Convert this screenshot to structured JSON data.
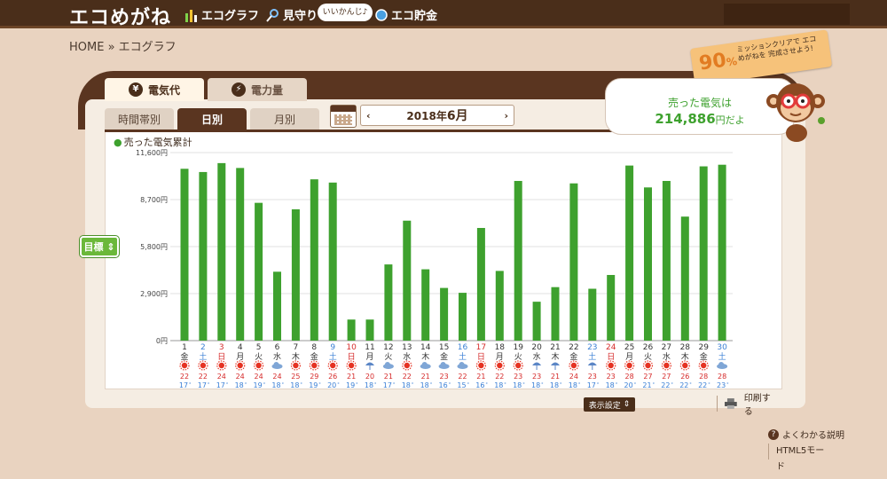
{
  "header": {
    "logo": "エコめがね",
    "nav": [
      {
        "label": "エコグラフ",
        "icon": "bar-chart-icon"
      },
      {
        "label": "見守り",
        "icon": "magnifier-icon"
      },
      {
        "label": "エコ貯金",
        "icon": "coin-icon"
      }
    ],
    "speech": "いいかんじ♪"
  },
  "breadcrumb": "HOME » エコグラフ",
  "mission": {
    "percent": "90",
    "unit": "%",
    "text": "ミッションクリアで エコめがねを 完成させよう!"
  },
  "tabs": [
    {
      "label": "電気代",
      "icon": "yen-icon"
    },
    {
      "label": "電力量",
      "icon": "bolt-icon"
    }
  ],
  "subtabs": [
    "時間帯別",
    "日別",
    "月別"
  ],
  "month": {
    "year": "2018年",
    "month": "6月",
    "prev": "‹",
    "next": "›"
  },
  "bubble": {
    "line1": "売った電気は",
    "amount": "214,886",
    "unit": "円だよ"
  },
  "legend": "売った電気累計",
  "goal_button": "目標",
  "display_button": "表示設定",
  "print_button": "印刷する",
  "faq": "よくわかる説明",
  "html5": "HTML5モード",
  "colors": {
    "bar": "#3ea12e",
    "brown": "#4a2e1a",
    "sat": "#3a7fd5",
    "sun": "#d62b2b",
    "hi": "#d62b2b",
    "lo": "#3a7fd5"
  },
  "chart_data": {
    "type": "bar",
    "title": "売った電気累計",
    "ylim": [
      0,
      11600
    ],
    "y_ticks": [
      "0円",
      "2,900円",
      "5,800円",
      "8,700円",
      "11,600円"
    ],
    "categories": [
      "1",
      "2",
      "3",
      "4",
      "5",
      "6",
      "7",
      "8",
      "9",
      "10",
      "11",
      "12",
      "13",
      "14",
      "15",
      "16",
      "17",
      "18",
      "19",
      "20",
      "21",
      "22",
      "23",
      "24",
      "25",
      "26",
      "27",
      "28",
      "29",
      "30"
    ],
    "weekdays": [
      "金",
      "土",
      "日",
      "月",
      "火",
      "水",
      "木",
      "金",
      "土",
      "日",
      "月",
      "火",
      "水",
      "木",
      "金",
      "土",
      "日",
      "月",
      "火",
      "水",
      "木",
      "金",
      "土",
      "日",
      "月",
      "火",
      "水",
      "木",
      "金",
      "土"
    ],
    "weather": [
      "sun",
      "sun",
      "sun",
      "sun",
      "sun",
      "cloud",
      "sun",
      "sun",
      "sun",
      "sun",
      "rain",
      "cloud",
      "sun",
      "cloud",
      "cloud",
      "cloud",
      "sun",
      "sun",
      "sun",
      "rain",
      "rain",
      "sun",
      "rain",
      "sun",
      "sun",
      "sun",
      "sun",
      "sun",
      "sun",
      "cloud"
    ],
    "high": [
      "22",
      "22",
      "24",
      "24",
      "24",
      "24",
      "25",
      "29",
      "26",
      "21",
      "20",
      "21",
      "22",
      "21",
      "23",
      "22",
      "21",
      "22",
      "23",
      "23",
      "21",
      "24",
      "23",
      "23",
      "28",
      "27",
      "27",
      "26",
      "28",
      "28"
    ],
    "low": [
      "17",
      "17",
      "17",
      "18",
      "19",
      "18",
      "18",
      "19",
      "20",
      "19",
      "18",
      "17",
      "18",
      "18",
      "16",
      "15",
      "16",
      "18",
      "18",
      "18",
      "18",
      "18",
      "17",
      "18",
      "20",
      "21",
      "22",
      "22",
      "22",
      "23"
    ],
    "series": [
      {
        "values": [
          10600,
          10400,
          10950,
          10650,
          8500,
          4250,
          8100,
          9950,
          9750,
          1300,
          1300,
          4700,
          7400,
          4400,
          3250,
          2950,
          6950,
          4300,
          9850,
          2400,
          3300,
          9700,
          3200,
          4050,
          10800,
          9450,
          9850,
          7650,
          10750,
          10850
        ]
      }
    ]
  }
}
